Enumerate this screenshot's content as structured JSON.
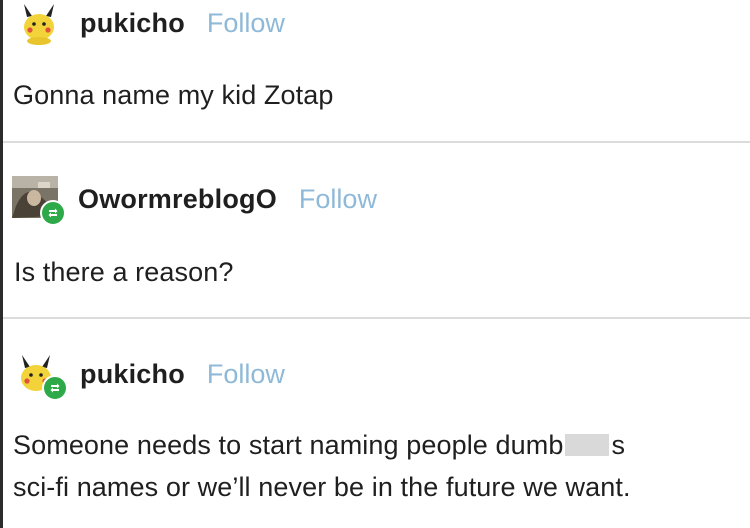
{
  "posts": [
    {
      "username": "pukicho",
      "follow_label": "Follow",
      "avatar_icon": "pikachu-avatar-icon",
      "reblog": false,
      "text": "Gonna name my kid Zotap"
    },
    {
      "username": "OwormreblogO",
      "follow_label": "Follow",
      "avatar_icon": "photo-avatar-icon",
      "reblog": true,
      "text": "Is there a reason?"
    },
    {
      "username": "pukicho",
      "follow_label": "Follow",
      "avatar_icon": "pikachu-avatar-icon",
      "reblog": true,
      "text_line1_before": "Someone needs to start naming people dumb",
      "text_line1_after": "s",
      "text_line2": "sci-fi names or we’ll never be in the future we want."
    }
  ],
  "colors": {
    "follow": "#8fb9d8",
    "reblog_badge": "#2ea94a",
    "divider": "#dcdcdc",
    "text": "#1f1f1f"
  }
}
